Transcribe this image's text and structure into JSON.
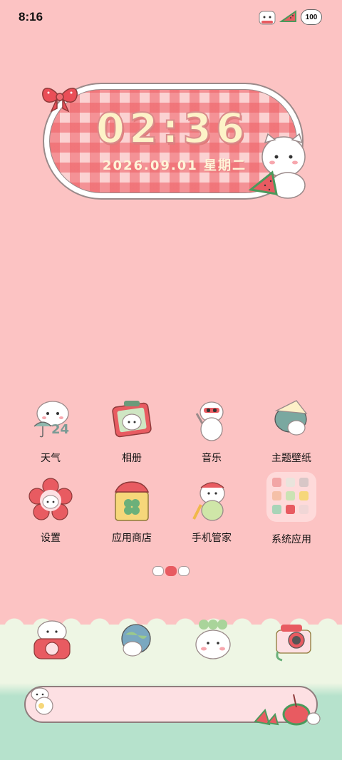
{
  "status_bar": {
    "time": "8:16",
    "battery": "100",
    "icons": [
      "cat-status-icon",
      "watermelon-status-icon",
      "battery-icon"
    ]
  },
  "clock_widget": {
    "time": "02:36",
    "date": "2026.09.01 星期二"
  },
  "apps": [
    {
      "label": "天气",
      "icon": "weather-cat-icon"
    },
    {
      "label": "相册",
      "icon": "gallery-cat-icon"
    },
    {
      "label": "音乐",
      "icon": "music-cat-icon"
    },
    {
      "label": "主题壁纸",
      "icon": "theme-wallpaper-icon"
    },
    {
      "label": "设置",
      "icon": "settings-flower-cat-icon"
    },
    {
      "label": "应用商店",
      "icon": "app-store-bag-icon"
    },
    {
      "label": "手机管家",
      "icon": "phone-manager-cat-icon"
    },
    {
      "label": "系统应用",
      "icon": "system-apps-folder-icon"
    }
  ],
  "weather_badge": "24",
  "dock": [
    {
      "icon": "phone-cat-icon"
    },
    {
      "icon": "browser-globe-cat-icon"
    },
    {
      "icon": "messages-cat-icon"
    },
    {
      "icon": "camera-icon"
    }
  ],
  "colors": {
    "background": "#fcc3c3",
    "gingham": "#ee5e64",
    "dock_green": "#b6e2cc",
    "search_bar": "#fde0e3"
  }
}
